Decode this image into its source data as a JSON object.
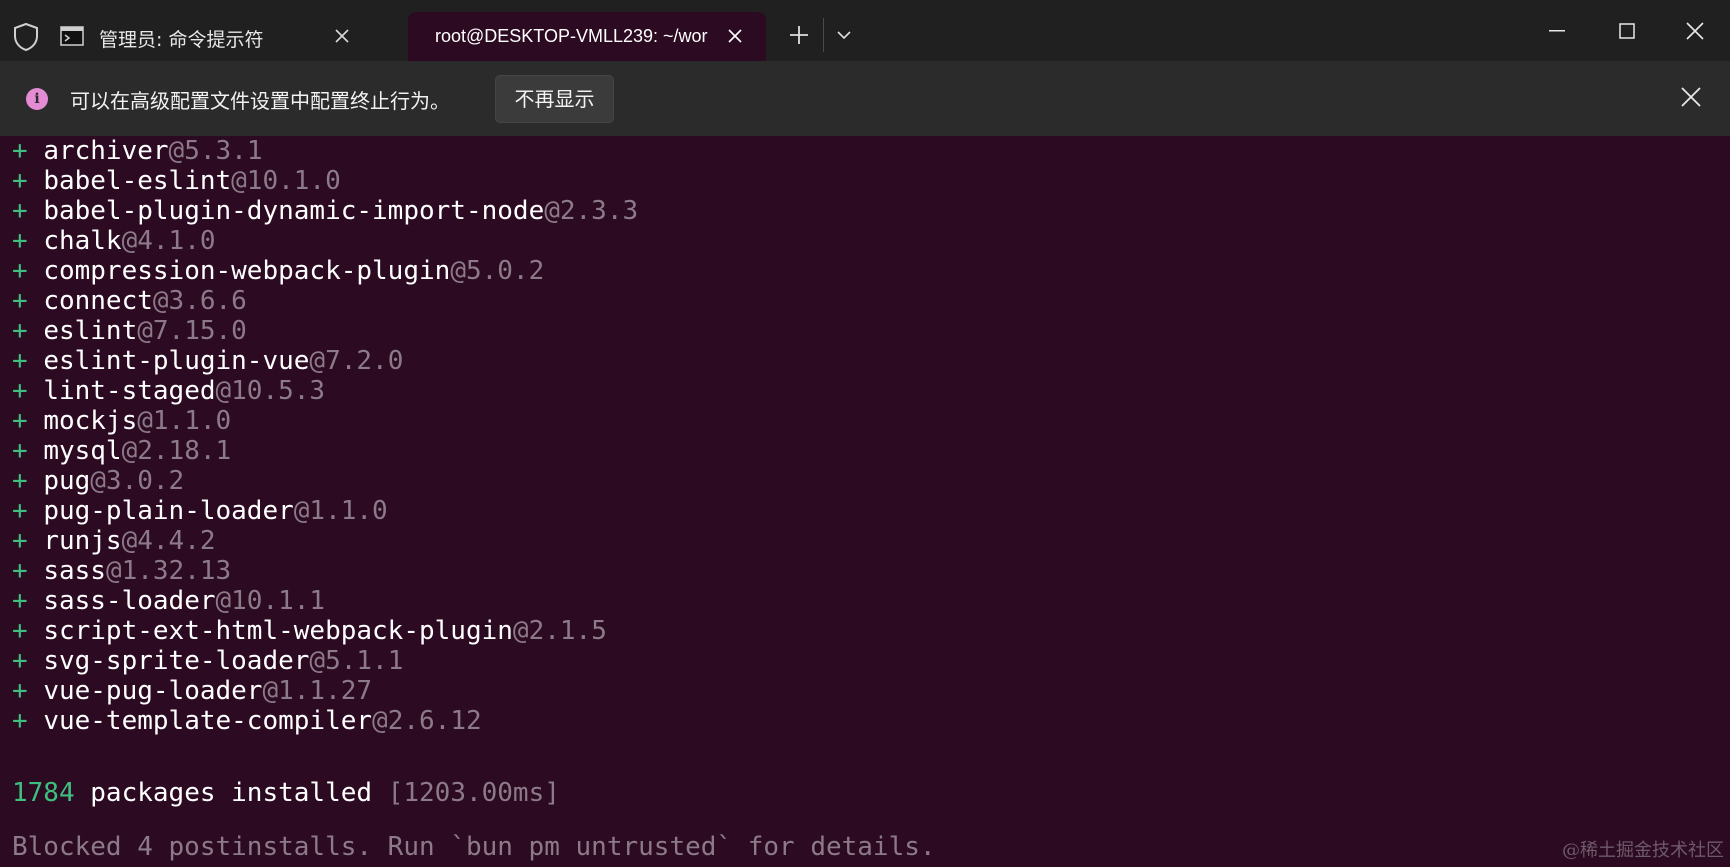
{
  "window": {
    "tabs": [
      {
        "title": "管理员: 命令提示符",
        "active": false,
        "icon": "terminal-icon"
      },
      {
        "title": "root@DESKTOP-VMLL239: ~/wor",
        "active": true
      }
    ],
    "icons": {
      "shield": "shield-icon",
      "new_tab": "plus-icon",
      "dropdown": "chevron-down-icon",
      "minimize": "minimize-icon",
      "maximize": "maximize-icon",
      "close": "close-icon"
    }
  },
  "infobar": {
    "icon": "info-icon",
    "icon_glyph": "i",
    "message": "可以在高级配置文件设置中配置终止行为。",
    "dismiss_label": "不再显示"
  },
  "terminal": {
    "packages": [
      {
        "plus": "+",
        "name": "archiver",
        "version": "@5.3.1"
      },
      {
        "plus": "+",
        "name": "babel-eslint",
        "version": "@10.1.0"
      },
      {
        "plus": "+",
        "name": "babel-plugin-dynamic-import-node",
        "version": "@2.3.3"
      },
      {
        "plus": "+",
        "name": "chalk",
        "version": "@4.1.0"
      },
      {
        "plus": "+",
        "name": "compression-webpack-plugin",
        "version": "@5.0.2"
      },
      {
        "plus": "+",
        "name": "connect",
        "version": "@3.6.6"
      },
      {
        "plus": "+",
        "name": "eslint",
        "version": "@7.15.0"
      },
      {
        "plus": "+",
        "name": "eslint-plugin-vue",
        "version": "@7.2.0"
      },
      {
        "plus": "+",
        "name": "lint-staged",
        "version": "@10.5.3"
      },
      {
        "plus": "+",
        "name": "mockjs",
        "version": "@1.1.0"
      },
      {
        "plus": "+",
        "name": "mysql",
        "version": "@2.18.1"
      },
      {
        "plus": "+",
        "name": "pug",
        "version": "@3.0.2"
      },
      {
        "plus": "+",
        "name": "pug-plain-loader",
        "version": "@1.1.0"
      },
      {
        "plus": "+",
        "name": "runjs",
        "version": "@4.4.2"
      },
      {
        "plus": "+",
        "name": "sass",
        "version": "@1.32.13"
      },
      {
        "plus": "+",
        "name": "sass-loader",
        "version": "@10.1.1"
      },
      {
        "plus": "+",
        "name": "script-ext-html-webpack-plugin",
        "version": "@2.1.5"
      },
      {
        "plus": "+",
        "name": "svg-sprite-loader",
        "version": "@5.1.1"
      },
      {
        "plus": "+",
        "name": "vue-pug-loader",
        "version": "@1.1.27"
      },
      {
        "plus": "+",
        "name": "vue-template-compiler",
        "version": "@2.6.12"
      }
    ],
    "summary": {
      "count": "1784",
      "text": " packages installed ",
      "timing": "[1203.00ms]"
    },
    "blocked_line": "Blocked 4 postinstalls. Run `bun pm untrusted` for details."
  },
  "watermark": "@稀土掘金技术社区",
  "colors": {
    "terminal_bg": "#2c0a22",
    "titlebar_bg": "#202020",
    "infobar_bg": "#2b2b2b",
    "plus_green": "#3fbf7f",
    "version_gray": "#8c7a88",
    "info_accent": "#e38bd3"
  }
}
